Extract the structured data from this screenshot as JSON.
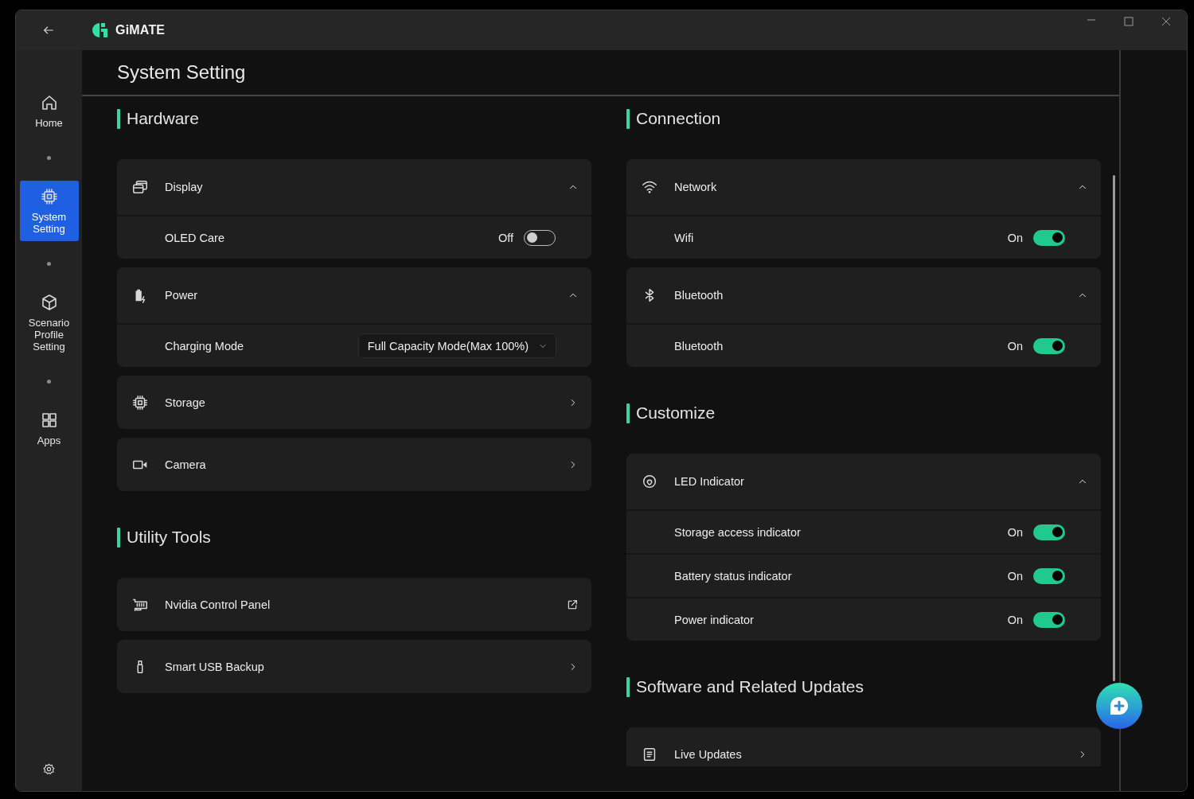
{
  "window": {
    "title": "GiMATE"
  },
  "nav": [
    {
      "label": "Home",
      "selected": false
    },
    {
      "label": "System Setting",
      "selected": true
    },
    {
      "label": "Scenario Profile Setting",
      "selected": false
    },
    {
      "label": "Apps",
      "selected": false
    }
  ],
  "page_title": "System Setting",
  "left_column": {
    "sections": [
      {
        "title": "Hardware",
        "cards": [
          {
            "label": "Display",
            "kind": "expandable",
            "expanded": true,
            "rows": [
              {
                "label": "OLED Care",
                "kind": "toggle",
                "on": false,
                "state_text": "Off"
              }
            ]
          },
          {
            "label": "Power",
            "kind": "expandable",
            "expanded": true,
            "rows": [
              {
                "label": "Charging Mode",
                "kind": "dropdown",
                "value": "Full Capacity Mode(Max 100%)"
              }
            ]
          },
          {
            "label": "Storage",
            "kind": "link"
          },
          {
            "label": "Camera",
            "kind": "link"
          }
        ]
      },
      {
        "title": "Utility Tools",
        "cards": [
          {
            "label": "Nvidia Control Panel",
            "kind": "external"
          },
          {
            "label": "Smart USB Backup",
            "kind": "link"
          }
        ]
      }
    ]
  },
  "right_column": {
    "sections": [
      {
        "title": "Connection",
        "cards": [
          {
            "label": "Network",
            "kind": "expandable",
            "expanded": true,
            "rows": [
              {
                "label": "Wifi",
                "kind": "toggle",
                "on": true,
                "state_text": "On"
              }
            ]
          },
          {
            "label": "Bluetooth",
            "kind": "expandable",
            "expanded": true,
            "rows": [
              {
                "label": "Bluetooth",
                "kind": "toggle",
                "on": true,
                "state_text": "On"
              }
            ]
          }
        ]
      },
      {
        "title": "Customize",
        "cards": [
          {
            "label": "LED Indicator",
            "kind": "expandable",
            "expanded": true,
            "rows": [
              {
                "label": "Storage access indicator",
                "kind": "toggle",
                "on": true,
                "state_text": "On"
              },
              {
                "label": "Battery status indicator",
                "kind": "toggle",
                "on": true,
                "state_text": "On"
              },
              {
                "label": "Power indicator",
                "kind": "toggle",
                "on": true,
                "state_text": "On"
              }
            ]
          }
        ]
      },
      {
        "title": "Software and Related Updates",
        "cards": [
          {
            "label": "Live Updates",
            "kind": "link"
          }
        ]
      }
    ]
  }
}
